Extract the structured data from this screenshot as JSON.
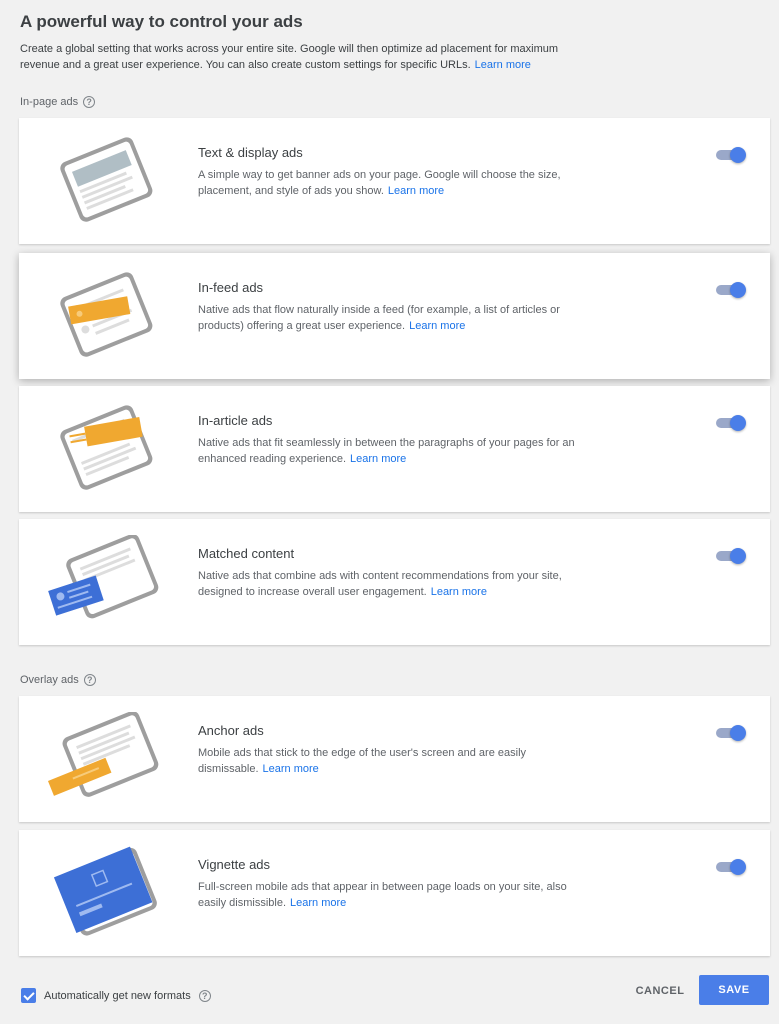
{
  "header": {
    "title": "A powerful way to control your ads",
    "description": "Create a global setting that works across your entire site. Google will then optimize ad placement for maximum revenue and a great user experience. You can also create custom settings for specific URLs.",
    "learn_more": "Learn more"
  },
  "sections": {
    "in_page_label": "In-page ads",
    "overlay_label": "Overlay ads"
  },
  "cards": [
    {
      "title": "Text & display ads",
      "description": "A simple way to get banner ads on your page. Google will choose the size, placement, and style of ads you show.",
      "learn_more": "Learn more",
      "enabled": true,
      "icon": "text-display-ads-illustration"
    },
    {
      "title": "In-feed ads",
      "description": "Native ads that flow naturally inside a feed (for example, a list of articles or products) offering a great user experience.",
      "learn_more": "Learn more",
      "enabled": true,
      "icon": "in-feed-ads-illustration"
    },
    {
      "title": "In-article ads",
      "description": "Native ads that fit seamlessly in between the paragraphs of your pages for an enhanced reading experience.",
      "learn_more": "Learn more",
      "enabled": true,
      "icon": "in-article-ads-illustration"
    },
    {
      "title": "Matched content",
      "description": "Native ads that combine ads with content recommendations from your site, designed to increase overall user engagement.",
      "learn_more": "Learn more",
      "enabled": true,
      "icon": "matched-content-illustration"
    },
    {
      "title": "Anchor ads",
      "description": "Mobile ads that stick to the edge of the user's screen and are easily dismissable.",
      "learn_more": "Learn more",
      "enabled": true,
      "icon": "anchor-ads-illustration"
    },
    {
      "title": "Vignette ads",
      "description": "Full-screen mobile ads that appear in between page loads on your site, also easily dismissible.",
      "learn_more": "Learn more",
      "enabled": true,
      "icon": "vignette-ads-illustration"
    }
  ],
  "footer": {
    "auto_formats_label": "Automatically get new formats",
    "auto_formats_checked": true,
    "cancel_label": "CANCEL",
    "save_label": "SAVE"
  },
  "colors": {
    "accent": "#4a7ee8",
    "ad_orange": "#f0a830",
    "ad_blue": "#3d6fd6"
  }
}
